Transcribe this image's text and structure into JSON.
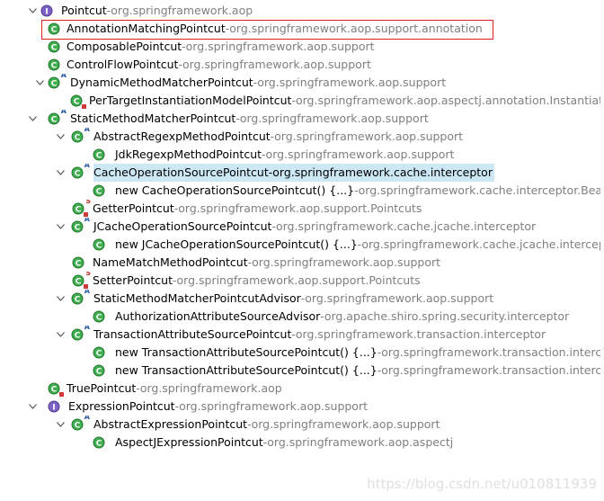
{
  "tree": [
    {
      "label": "Pointcut",
      "pkg": "org.springframework.aop",
      "icon": "interface",
      "twisty": "open"
    },
    {
      "label": "AnnotationMatchingPointcut",
      "pkg": "org.springframework.aop.support.annotation",
      "icon": "class",
      "twisty": "none"
    },
    {
      "label": "ComposablePointcut",
      "pkg": "org.springframework.aop.support",
      "icon": "class",
      "twisty": "none"
    },
    {
      "label": "ControlFlowPointcut",
      "pkg": "org.springframework.aop.support",
      "icon": "class",
      "twisty": "none"
    },
    {
      "label": "DynamicMethodMatcherPointcut",
      "pkg": "org.springframework.aop.support",
      "icon": "class-abstract",
      "twisty": "open"
    },
    {
      "label": "PerTargetInstantiationModelPointcut",
      "pkg": "org.springframework.aop.aspectj.annotation.InstantiationM",
      "icon": "class-private",
      "twisty": "none"
    },
    {
      "label": "StaticMethodMatcherPointcut",
      "pkg": "org.springframework.aop.support",
      "icon": "class-abstract",
      "twisty": "open"
    },
    {
      "label": "AbstractRegexpMethodPointcut",
      "pkg": "org.springframework.aop.support",
      "icon": "class-abstract",
      "twisty": "open"
    },
    {
      "label": "JdkRegexpMethodPointcut",
      "pkg": "org.springframework.aop.support",
      "icon": "class",
      "twisty": "none"
    },
    {
      "label": "CacheOperationSourcePointcut",
      "pkg": "org.springframework.cache.interceptor",
      "icon": "class-abstract",
      "twisty": "open"
    },
    {
      "label": "new CacheOperationSourcePointcut() {...}",
      "pkg": "org.springframework.cache.interceptor.BeanFacto",
      "icon": "anon",
      "twisty": "none"
    },
    {
      "label": "GetterPointcut",
      "pkg": "org.springframework.aop.support.Pointcuts",
      "icon": "class-static-private",
      "twisty": "none"
    },
    {
      "label": "JCacheOperationSourcePointcut",
      "pkg": "org.springframework.cache.jcache.interceptor",
      "icon": "class-abstract",
      "twisty": "open"
    },
    {
      "label": "new JCacheOperationSourcePointcut() {...}",
      "pkg": "org.springframework.cache.jcache.interceptor.Be",
      "icon": "anon",
      "twisty": "none"
    },
    {
      "label": "NameMatchMethodPointcut",
      "pkg": "org.springframework.aop.support",
      "icon": "class",
      "twisty": "none"
    },
    {
      "label": "SetterPointcut",
      "pkg": "org.springframework.aop.support.Pointcuts",
      "icon": "class-static-private",
      "twisty": "none"
    },
    {
      "label": "StaticMethodMatcherPointcutAdvisor",
      "pkg": "org.springframework.aop.support",
      "icon": "class-abstract",
      "twisty": "open"
    },
    {
      "label": "AuthorizationAttributeSourceAdvisor",
      "pkg": "org.apache.shiro.spring.security.interceptor",
      "icon": "class",
      "twisty": "none"
    },
    {
      "label": "TransactionAttributeSourcePointcut",
      "pkg": "org.springframework.transaction.interceptor",
      "icon": "class-abstract",
      "twisty": "open"
    },
    {
      "label": "new TransactionAttributeSourcePointcut() {...}",
      "pkg": "org.springframework.transaction.interceptor.B",
      "icon": "anon",
      "twisty": "none"
    },
    {
      "label": "new TransactionAttributeSourcePointcut() {...}",
      "pkg": "org.springframework.transaction.interceptor.T",
      "icon": "anon",
      "twisty": "none"
    },
    {
      "label": "TruePointcut",
      "pkg": "org.springframework.aop",
      "icon": "class-private",
      "twisty": "none"
    },
    {
      "label": "ExpressionPointcut",
      "pkg": "org.springframework.aop.support",
      "icon": "interface",
      "twisty": "open"
    },
    {
      "label": "AbstractExpressionPointcut",
      "pkg": "org.springframework.aop.support",
      "icon": "class-abstract",
      "twisty": "open"
    },
    {
      "label": "AspectJExpressionPointcut",
      "pkg": "org.springframework.aop.aspectj",
      "icon": "class",
      "twisty": "none"
    }
  ],
  "separator": " - ",
  "selected_row": "CacheOperationSourcePointcut",
  "highlighted_row": "AnnotationMatchingPointcut",
  "watermark": "https://blog.csdn.net/u010811939",
  "colors": {
    "class": "#2e9a3e",
    "interface": "#6b4fb1",
    "selection": "#cce8f4",
    "package": "#7f7f7f",
    "highlight_border": "#e02020"
  }
}
